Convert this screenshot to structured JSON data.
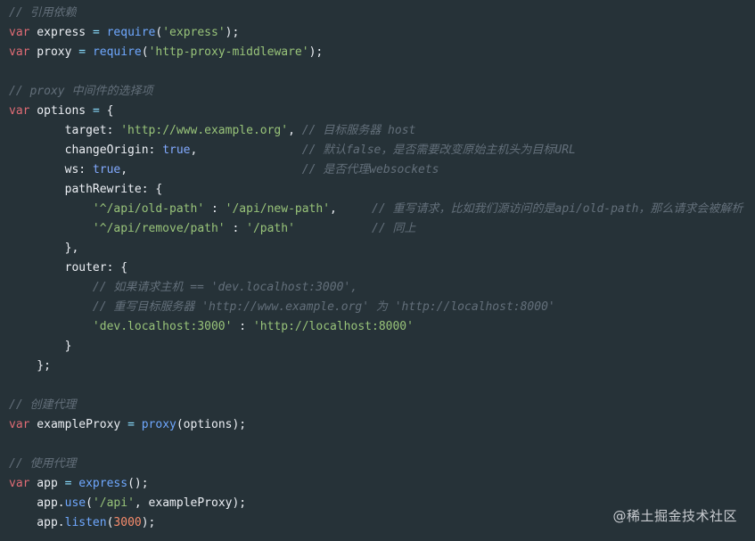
{
  "lines": [
    [
      {
        "c": "cm",
        "t": "// 引用依赖"
      }
    ],
    [
      {
        "c": "kw",
        "t": "var"
      },
      {
        "c": "id",
        "t": " express "
      },
      {
        "c": "op",
        "t": "="
      },
      {
        "c": "id",
        "t": " "
      },
      {
        "c": "fn",
        "t": "require"
      },
      {
        "c": "punc",
        "t": "("
      },
      {
        "c": "str",
        "t": "'express'"
      },
      {
        "c": "punc",
        "t": ");"
      }
    ],
    [
      {
        "c": "kw",
        "t": "var"
      },
      {
        "c": "id",
        "t": " proxy "
      },
      {
        "c": "op",
        "t": "="
      },
      {
        "c": "id",
        "t": " "
      },
      {
        "c": "fn",
        "t": "require"
      },
      {
        "c": "punc",
        "t": "("
      },
      {
        "c": "str",
        "t": "'http-proxy-middleware'"
      },
      {
        "c": "punc",
        "t": ");"
      }
    ],
    [],
    [
      {
        "c": "cm",
        "t": "// proxy 中间件的选择项"
      }
    ],
    [
      {
        "c": "kw",
        "t": "var"
      },
      {
        "c": "id",
        "t": " options "
      },
      {
        "c": "op",
        "t": "="
      },
      {
        "c": "punc",
        "t": " {"
      }
    ],
    [
      {
        "c": "prop",
        "t": "        target"
      },
      {
        "c": "punc",
        "t": ": "
      },
      {
        "c": "str",
        "t": "'http://www.example.org'"
      },
      {
        "c": "punc",
        "t": ", "
      },
      {
        "c": "cm",
        "t": "// 目标服务器 host"
      }
    ],
    [
      {
        "c": "prop",
        "t": "        changeOrigin"
      },
      {
        "c": "punc",
        "t": ": "
      },
      {
        "c": "bool",
        "t": "true"
      },
      {
        "c": "punc",
        "t": ",               "
      },
      {
        "c": "cm",
        "t": "// 默认false，是否需要改变原始主机头为目标URL"
      }
    ],
    [
      {
        "c": "prop",
        "t": "        ws"
      },
      {
        "c": "punc",
        "t": ": "
      },
      {
        "c": "bool",
        "t": "true"
      },
      {
        "c": "punc",
        "t": ",                         "
      },
      {
        "c": "cm",
        "t": "// 是否代理websockets"
      }
    ],
    [
      {
        "c": "prop",
        "t": "        pathRewrite"
      },
      {
        "c": "punc",
        "t": ": {"
      }
    ],
    [
      {
        "c": "str",
        "t": "            '^/api/old-path'"
      },
      {
        "c": "punc",
        "t": " : "
      },
      {
        "c": "str",
        "t": "'/api/new-path'"
      },
      {
        "c": "punc",
        "t": ",     "
      },
      {
        "c": "cm",
        "t": "// 重写请求，比如我们源访问的是api/old-path，那么请求会被解析"
      }
    ],
    [
      {
        "c": "str",
        "t": "            '^/api/remove/path'"
      },
      {
        "c": "punc",
        "t": " : "
      },
      {
        "c": "str",
        "t": "'/path'"
      },
      {
        "c": "punc",
        "t": "           "
      },
      {
        "c": "cm",
        "t": "// 同上"
      }
    ],
    [
      {
        "c": "punc",
        "t": "        },"
      }
    ],
    [
      {
        "c": "prop",
        "t": "        router"
      },
      {
        "c": "punc",
        "t": ": {"
      }
    ],
    [
      {
        "c": "cm",
        "t": "            // 如果请求主机 == 'dev.localhost:3000',"
      }
    ],
    [
      {
        "c": "cm",
        "t": "            // 重写目标服务器 'http://www.example.org' 为 'http://localhost:8000'"
      }
    ],
    [
      {
        "c": "str",
        "t": "            'dev.localhost:3000'"
      },
      {
        "c": "punc",
        "t": " : "
      },
      {
        "c": "str",
        "t": "'http://localhost:8000'"
      }
    ],
    [
      {
        "c": "punc",
        "t": "        }"
      }
    ],
    [
      {
        "c": "punc",
        "t": "    };"
      }
    ],
    [],
    [
      {
        "c": "cm",
        "t": "// 创建代理"
      }
    ],
    [
      {
        "c": "kw",
        "t": "var"
      },
      {
        "c": "id",
        "t": " exampleProxy "
      },
      {
        "c": "op",
        "t": "="
      },
      {
        "c": "id",
        "t": " "
      },
      {
        "c": "fn",
        "t": "proxy"
      },
      {
        "c": "punc",
        "t": "(options);"
      }
    ],
    [],
    [
      {
        "c": "cm",
        "t": "// 使用代理"
      }
    ],
    [
      {
        "c": "kw",
        "t": "var"
      },
      {
        "c": "id",
        "t": " app "
      },
      {
        "c": "op",
        "t": "="
      },
      {
        "c": "id",
        "t": " "
      },
      {
        "c": "fn",
        "t": "express"
      },
      {
        "c": "punc",
        "t": "();"
      }
    ],
    [
      {
        "c": "id",
        "t": "    app."
      },
      {
        "c": "fn",
        "t": "use"
      },
      {
        "c": "punc",
        "t": "("
      },
      {
        "c": "str",
        "t": "'/api'"
      },
      {
        "c": "punc",
        "t": ", exampleProxy);"
      }
    ],
    [
      {
        "c": "id",
        "t": "    app."
      },
      {
        "c": "fn",
        "t": "listen"
      },
      {
        "c": "punc",
        "t": "("
      },
      {
        "c": "num",
        "t": "3000"
      },
      {
        "c": "punc",
        "t": ");"
      }
    ]
  ],
  "watermark": "@稀土掘金技术社区"
}
